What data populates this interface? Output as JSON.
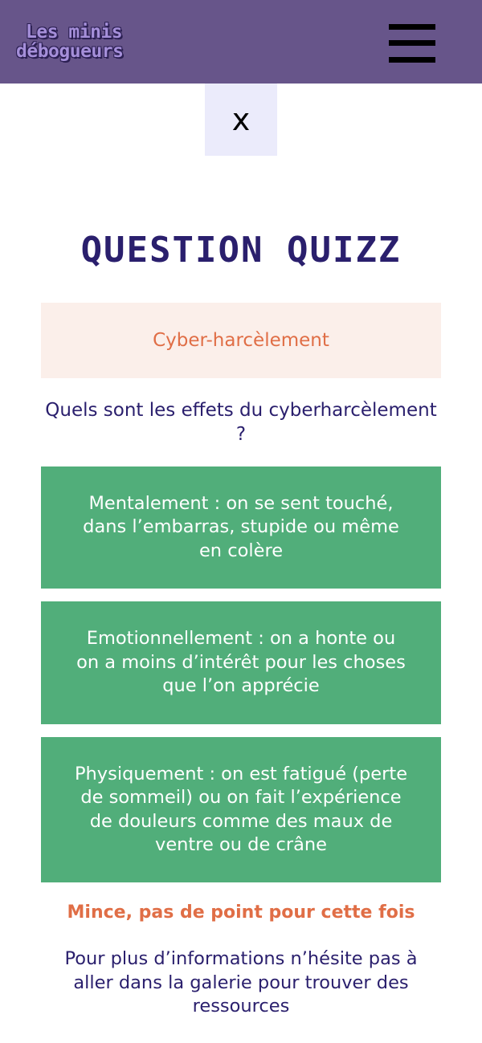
{
  "header": {
    "logo_line1": "Les minis",
    "logo_line2": "débogueurs",
    "menu_icon": "hamburger-menu-icon"
  },
  "close_button": {
    "label": "x"
  },
  "quiz": {
    "title": "QUESTION QUIZZ",
    "category": "Cyber-harcèlement",
    "question": "Quels sont les effets du cyberharcèlement ?",
    "answers": [
      "Mentalement : on se sent touché, dans l’embarras, stupide ou même en colère",
      "Emotionnellement : on a honte ou on a moins d’intérêt pour les choses que l’on apprécie",
      "Physiquement : on est fatigué (perte de sommeil) ou on fait l’expérience de douleurs comme des maux de ventre ou de crâne"
    ],
    "result": "Mince, pas de point pour cette fois",
    "info": "Pour plus d’informations n’hésite pas à aller dans la galerie pour trouver des ressources"
  },
  "colors": {
    "header_bg": "#67558a",
    "title": "#2a1f6d",
    "accent_orange": "#e06e46",
    "answer_bg": "#51ae7a",
    "category_bg": "#fbefea",
    "close_bg": "#ebebfb"
  }
}
